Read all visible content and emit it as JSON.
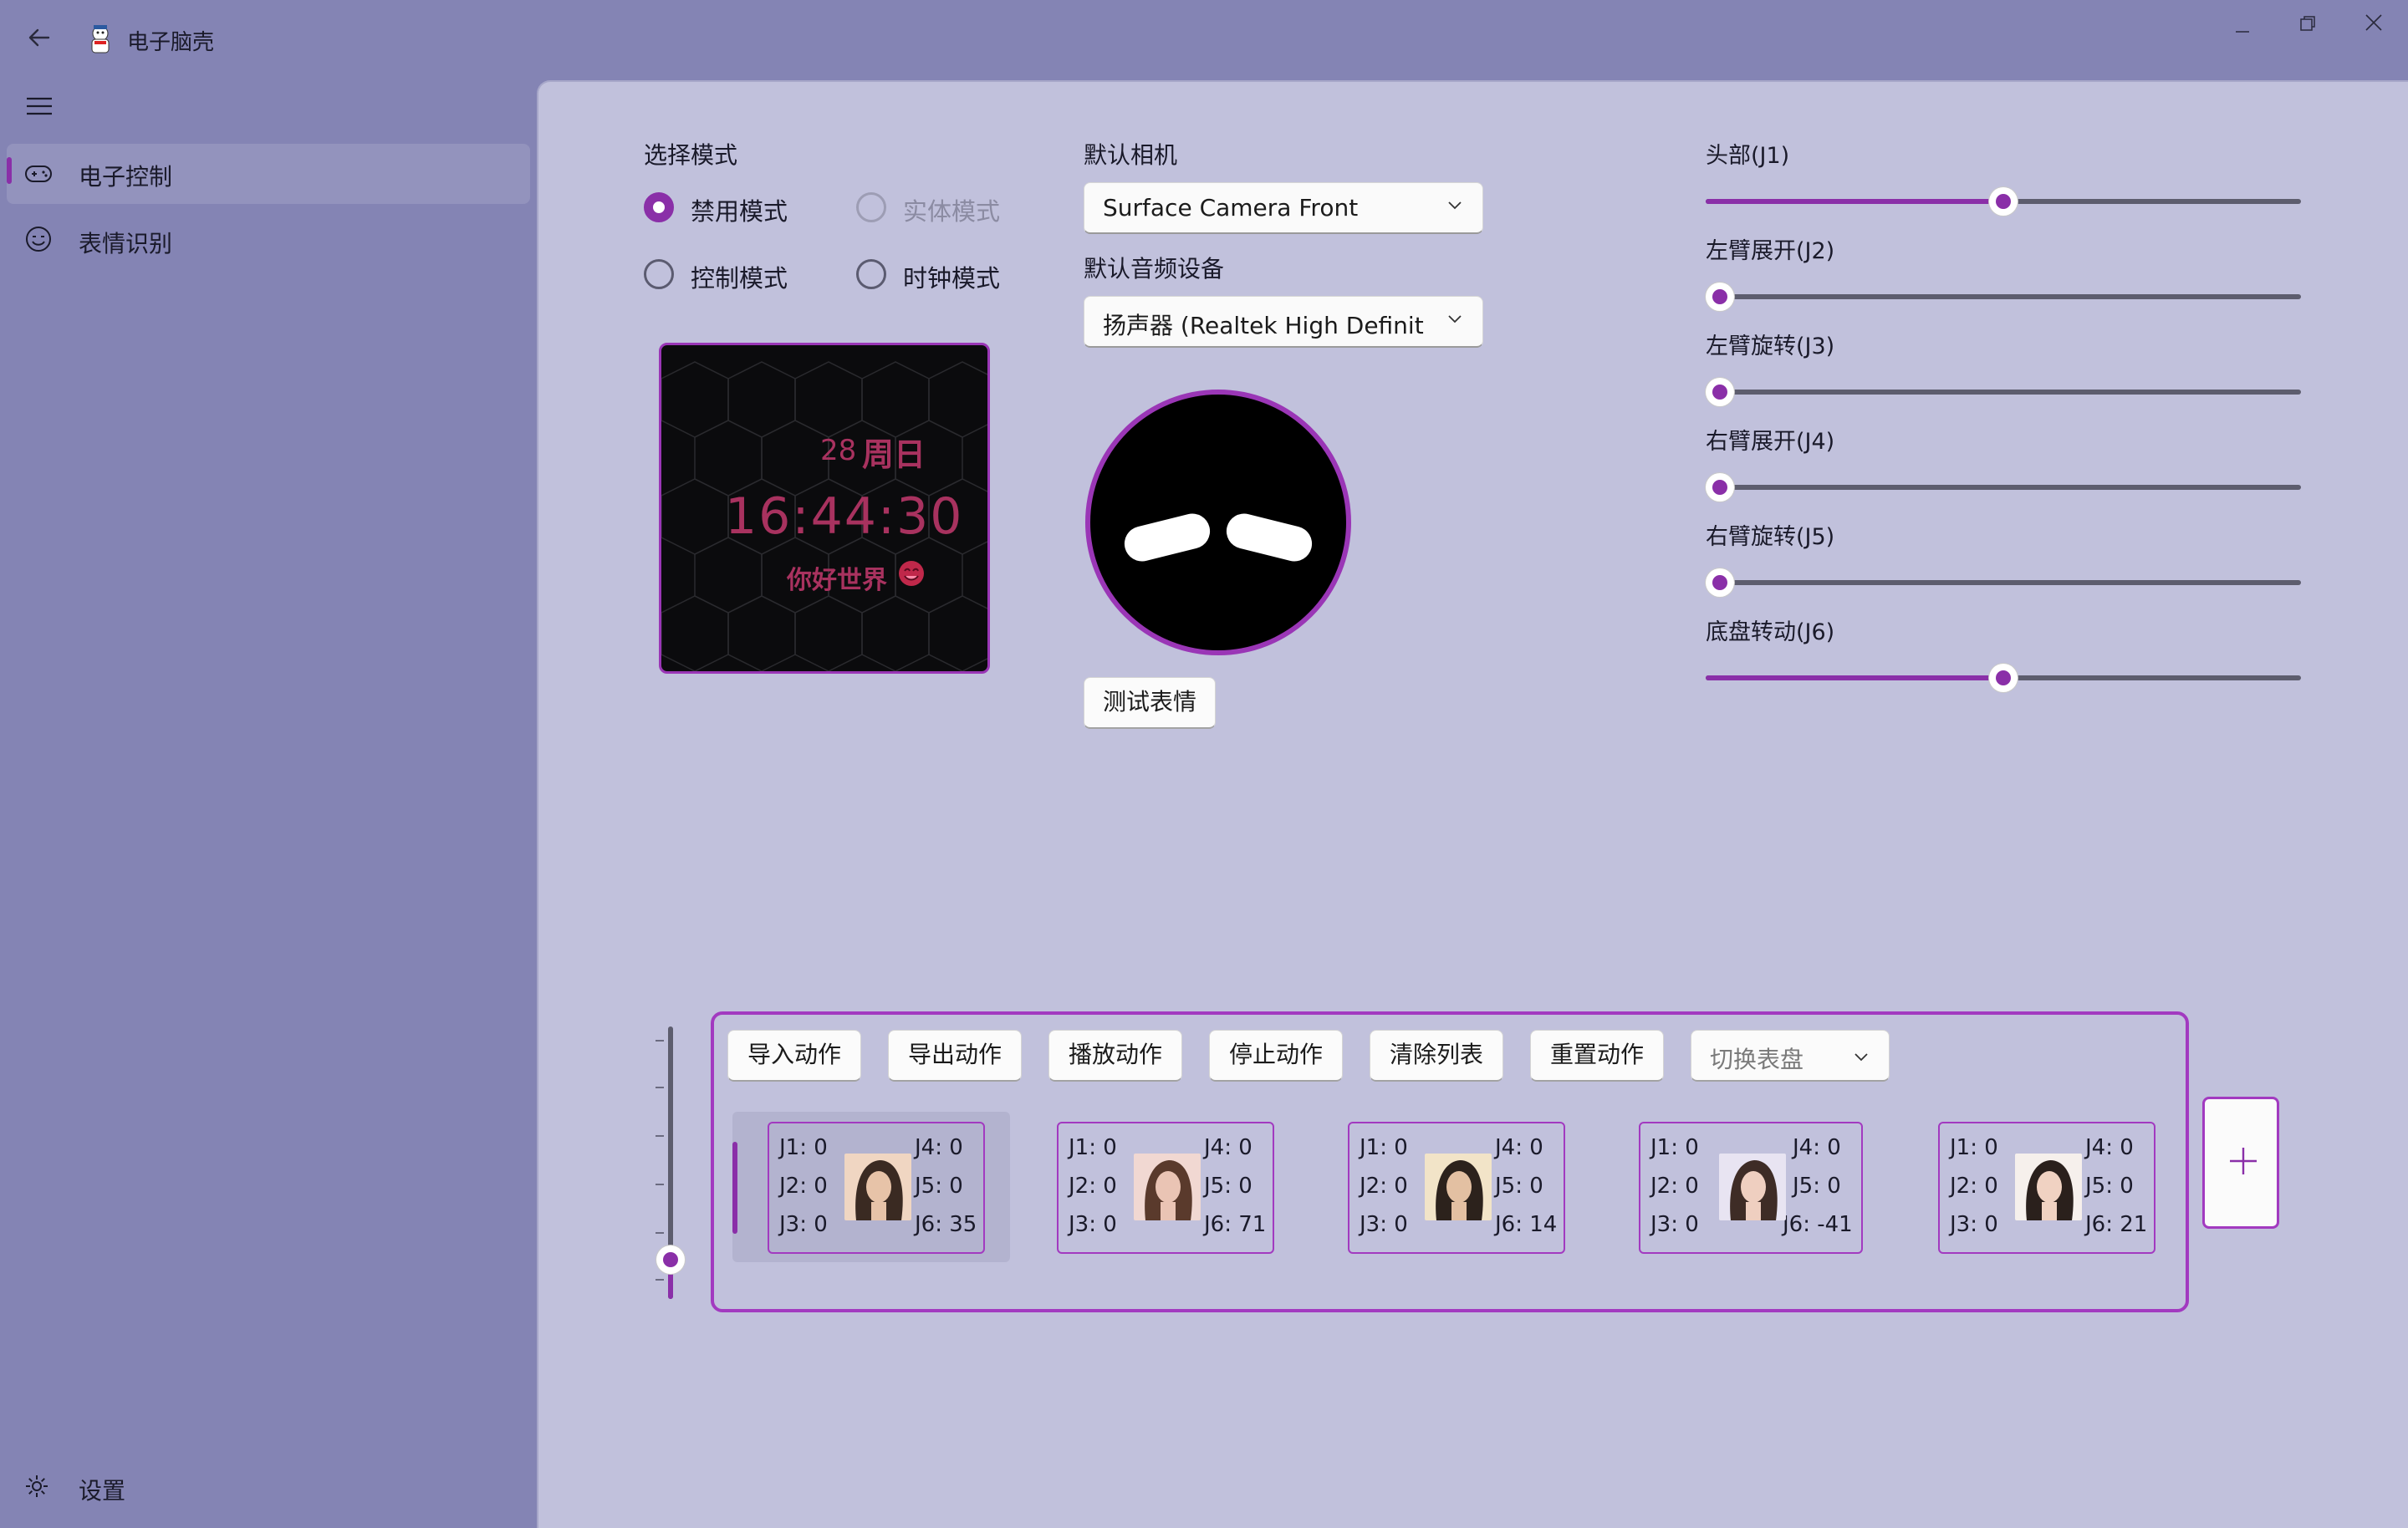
{
  "window": {
    "title": "电子脑壳",
    "back_icon": "back-arrow-icon"
  },
  "sidebar": {
    "items": [
      {
        "label": "电子控制",
        "icon": "gamepad-icon",
        "active": true
      },
      {
        "label": "表情识别",
        "icon": "smile-face-icon",
        "active": false
      }
    ],
    "settings_label": "设置"
  },
  "mode": {
    "label": "选择模式",
    "options": [
      {
        "label": "禁用模式",
        "checked": true,
        "disabled": false
      },
      {
        "label": "实体模式",
        "checked": false,
        "disabled": true
      },
      {
        "label": "控制模式",
        "checked": false,
        "disabled": false
      },
      {
        "label": "时钟模式",
        "checked": false,
        "disabled": false
      }
    ]
  },
  "dial": {
    "day": "28",
    "weekday": "周日",
    "time": "16:44:30",
    "greeting": "你好世界"
  },
  "camera": {
    "label": "默认相机",
    "value": "Surface Camera Front"
  },
  "audio": {
    "label": "默认音频设备",
    "value": "扬声器 (Realtek High Definition Audio)"
  },
  "test_expression_label": "测试表情",
  "joints": [
    {
      "label": "头部(J1)",
      "value": 0.5
    },
    {
      "label": "左臂展开(J2)",
      "value": 0.0
    },
    {
      "label": "左臂旋转(J3)",
      "value": 0.0
    },
    {
      "label": "右臂展开(J4)",
      "value": 0.0
    },
    {
      "label": "右臂旋转(J5)",
      "value": 0.0
    },
    {
      "label": "底盘转动(J6)",
      "value": 0.5
    }
  ],
  "actions": {
    "buttons": [
      "导入动作",
      "导出动作",
      "播放动作",
      "停止动作",
      "清除列表",
      "重置动作"
    ],
    "dial_switch_placeholder": "切换表盘",
    "frames": [
      {
        "j1": "J1: 0",
        "j2": "J2: 0",
        "j3": "J3: 0",
        "j4": "J4: 0",
        "j5": "J5: 0",
        "j6": "J6: 35",
        "selected": true
      },
      {
        "j1": "J1: 0",
        "j2": "J2: 0",
        "j3": "J3: 0",
        "j4": "J4: 0",
        "j5": "J5: 0",
        "j6": "J6: 71",
        "selected": false
      },
      {
        "j1": "J1: 0",
        "j2": "J2: 0",
        "j3": "J3: 0",
        "j4": "J4: 0",
        "j5": "J5: 0",
        "j6": "J6: 14",
        "selected": false
      },
      {
        "j1": "J1: 0",
        "j2": "J2: 0",
        "j3": "J3: 0",
        "j4": "J4: 0",
        "j5": "J5: 0",
        "j6": "J6: -41",
        "selected": false
      },
      {
        "j1": "J1: 0",
        "j2": "J2: 0",
        "j3": "J3: 0",
        "j4": "J4: 0",
        "j5": "J5: 0",
        "j6": "J6: 21",
        "selected": false
      }
    ],
    "add_label": "+",
    "timeline_value": 0.0
  },
  "colors": {
    "accent": "#8a2fa8",
    "sidebar": "#8484b4",
    "content": "#c1c1dc"
  }
}
